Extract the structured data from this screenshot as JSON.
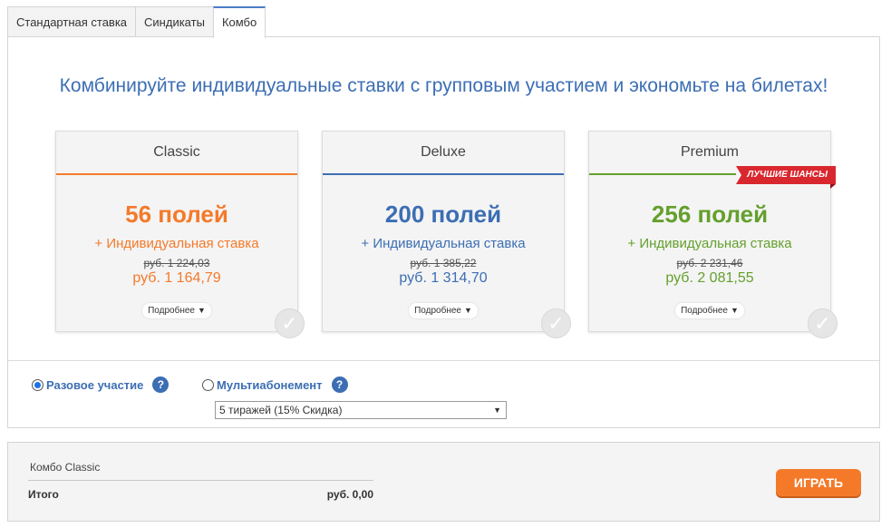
{
  "tabs": [
    {
      "label": "Стандартная ставка"
    },
    {
      "label": "Синдикаты"
    },
    {
      "label": "Комбо"
    }
  ],
  "headline": "Комбинируйте индивидуальные ставки с групповым участием и экономьте на билетах!",
  "cards": [
    {
      "title": "Classic",
      "fields": "56 полей",
      "plus": "+ Индивидуальная ставка",
      "old_price": "руб. 1 224,03",
      "new_price": "руб. 1 164,79",
      "more": "Подробнее"
    },
    {
      "title": "Deluxe",
      "fields": "200 полей",
      "plus": "+ Индивидуальная ставка",
      "old_price": "руб. 1 385,22",
      "new_price": "руб. 1 314,70",
      "more": "Подробнее"
    },
    {
      "title": "Premium",
      "fields": "256 полей",
      "plus": "+ Индивидуальная ставка",
      "old_price": "руб. 2 231,46",
      "new_price": "руб. 2 081,55",
      "more": "Подробнее",
      "ribbon": "ЛУЧШИЕ ШАНСЫ"
    }
  ],
  "options": {
    "single": "Разовое участие",
    "multi": "Мультиабонемент",
    "help": "?",
    "select_value": "5 тиражей (15% Скидка)"
  },
  "summary": {
    "combo_name": "Комбо Classic",
    "total_label": "Итого",
    "total_value": "руб. 0,00",
    "play_label": "ИГРАТЬ"
  },
  "colors": {
    "classic": "#f47a2a",
    "deluxe": "#3c6eb4",
    "premium": "#64a02d",
    "ribbon": "#d9272e"
  }
}
